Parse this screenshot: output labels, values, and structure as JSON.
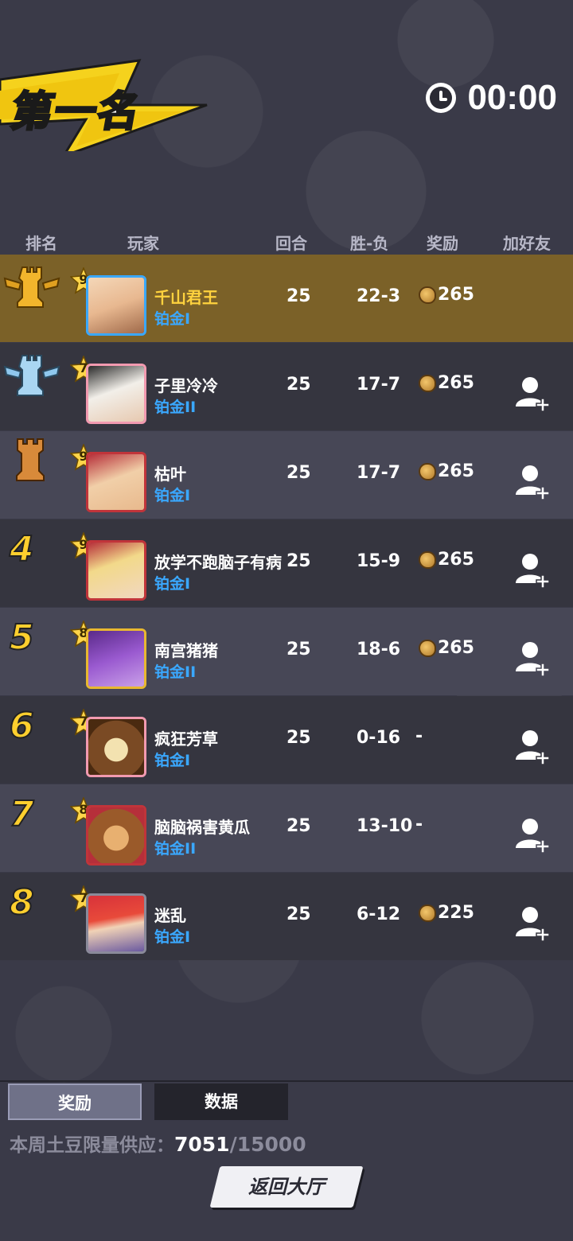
{
  "title": "第一名",
  "timer": "00:00",
  "headers": {
    "rank": "排名",
    "player": "玩家",
    "rounds": "回合",
    "win_loss": "胜-负",
    "reward": "奖励",
    "add_friend": "加好友"
  },
  "rows": [
    {
      "rank": "1",
      "level": "9",
      "name": "千山君王",
      "tier": "铂金I",
      "rounds": "25",
      "wl": "22-3",
      "reward": "265"
    },
    {
      "rank": "2",
      "level": "7",
      "name": "子里冷冷",
      "tier": "铂金II",
      "rounds": "25",
      "wl": "17-7",
      "reward": "265"
    },
    {
      "rank": "3",
      "level": "9",
      "name": "枯叶",
      "tier": "铂金I",
      "rounds": "25",
      "wl": "17-7",
      "reward": "265"
    },
    {
      "rank": "4",
      "level": "9",
      "name": "放学不跑脑子有病",
      "tier": "铂金I",
      "rounds": "25",
      "wl": "15-9",
      "reward": "265"
    },
    {
      "rank": "5",
      "level": "8",
      "name": "南宫猪猪",
      "tier": "铂金II",
      "rounds": "25",
      "wl": "18-6",
      "reward": "265"
    },
    {
      "rank": "6",
      "level": "7",
      "name": "疯狂芳草",
      "tier": "铂金I",
      "rounds": "25",
      "wl": "0-16",
      "reward": "-"
    },
    {
      "rank": "7",
      "level": "8",
      "name": "脑脑祸害黄瓜",
      "tier": "铂金II",
      "rounds": "25",
      "wl": "13-10",
      "reward": "-"
    },
    {
      "rank": "8",
      "level": "7",
      "name": "迷乱",
      "tier": "铂金I",
      "rounds": "25",
      "wl": "6-12",
      "reward": "225"
    }
  ],
  "tabs": {
    "reward": "奖励",
    "data": "数据"
  },
  "supply": {
    "label": "本周土豆限量供应：",
    "current": "7051",
    "max": "/15000"
  },
  "back_button": "返回大厅",
  "colors": {
    "gold": "#ffcf2e",
    "tier_blue": "#3aa8ff",
    "first_row": "#7b6128"
  }
}
